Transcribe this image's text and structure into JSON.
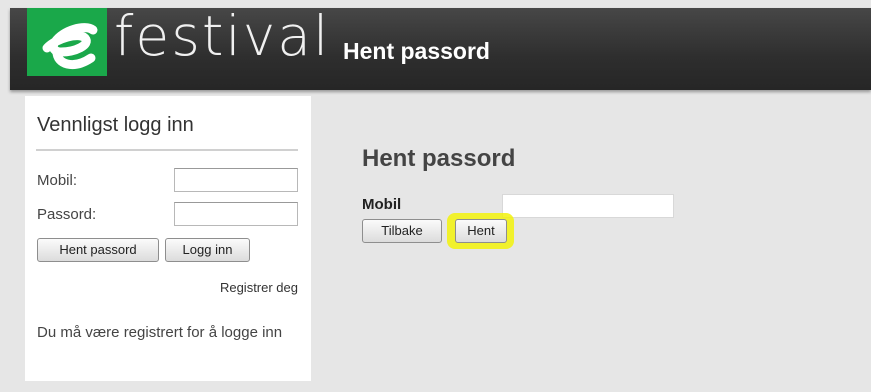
{
  "header": {
    "brand_name": "festival",
    "brand_logo_letter": "e",
    "title": "Hent passord"
  },
  "login_panel": {
    "title": "Vennligst logg inn",
    "mobile_label": "Mobil:",
    "mobile_value": "",
    "password_label": "Passord:",
    "password_value": "",
    "fetch_password_button": "Hent passord",
    "login_button": "Logg inn",
    "register_link": "Registrer deg",
    "note": "Du må være registrert for å logge inn"
  },
  "main": {
    "title": "Hent passord",
    "mobile_label": "Mobil",
    "mobile_value": "",
    "back_button": "Tilbake",
    "fetch_button": "Hent"
  },
  "colors": {
    "header_background": "#2e2e2e",
    "logo_green": "#1aa84a",
    "page_background": "#e6e6e6",
    "highlight": "#f2f20a"
  }
}
